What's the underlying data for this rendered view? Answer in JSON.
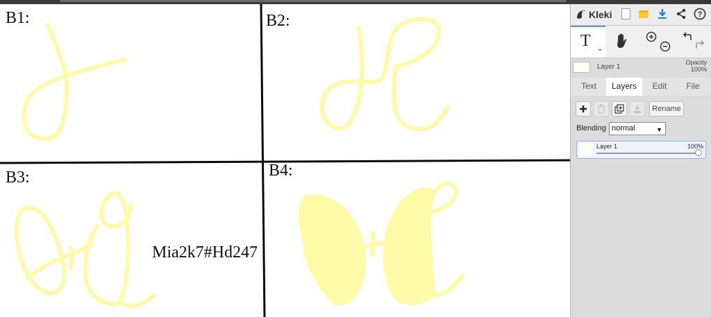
{
  "canvas": {
    "labels": {
      "b1": "B1:",
      "b2": "B2:",
      "b3": "B3:",
      "b4": "B4:"
    },
    "overlay_text": "Mia2k7#Hd247",
    "stroke_color": "#fffaa8",
    "grid_color": "#0a0a0a"
  },
  "panel": {
    "app_name": "Kleki",
    "header_icons": [
      "kleki-logo-icon",
      "new-image-icon",
      "open-folder-icon",
      "download-icon",
      "share-icon",
      "help-icon"
    ],
    "help_glyph": "?",
    "tools": {
      "text_glyph": "T",
      "caret_glyph": "⌄",
      "icons": [
        "text-tool-icon",
        "hand-tool-icon",
        "zoom-in-icon",
        "zoom-out-icon",
        "undo-icon",
        "redo-icon"
      ]
    },
    "current_layer": {
      "name": "Layer 1",
      "opacity_label": "Opacity",
      "opacity_value": "100%"
    },
    "tabs": [
      {
        "label": "Text"
      },
      {
        "label": "Layers"
      },
      {
        "label": "Edit"
      },
      {
        "label": "File"
      }
    ],
    "active_tab": "Layers",
    "layer_actions": {
      "icons": [
        "add-layer-icon",
        "delete-layer-icon",
        "duplicate-layer-icon",
        "merge-down-icon"
      ],
      "rename_label": "Rename"
    },
    "blending": {
      "label": "Blending",
      "value": "normal"
    },
    "layers_list": [
      {
        "name": "Layer 1",
        "opacity": "100%",
        "opacity_fraction": 1.0
      }
    ],
    "accent_color": "#5b8fd6",
    "download_color": "#1a7fd1",
    "folder_color": "#f5b400"
  }
}
